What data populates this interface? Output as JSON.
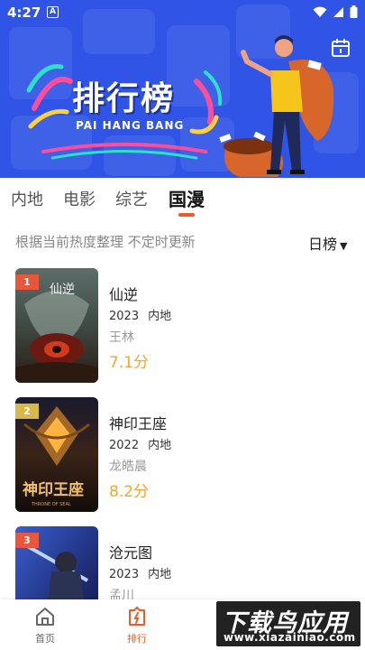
{
  "status_bar": {
    "time": "4:27",
    "notification_letter": "A"
  },
  "banner": {
    "title": "排行榜",
    "subtitle": "PAI HANG BANG"
  },
  "tabs": [
    {
      "label": "内地"
    },
    {
      "label": "电影"
    },
    {
      "label": "综艺"
    },
    {
      "label": "国漫"
    }
  ],
  "active_tab": "国漫",
  "subheader": "根据当前热度整理 不定时更新",
  "period_selector": "日榜",
  "list": [
    {
      "rank": "1",
      "title": "仙逆",
      "year": "2023",
      "region": "内地",
      "role": "王林",
      "score": "7.1分",
      "poster_title": "仙逆"
    },
    {
      "rank": "2",
      "title": "神印王座",
      "year": "2022",
      "region": "内地",
      "role": "龙皓晨",
      "score": "8.2分",
      "poster_title": "神印王座",
      "poster_subtitle": "THRONE OF SEAL"
    },
    {
      "rank": "3",
      "title": "沧元图",
      "year": "2023",
      "region": "内地",
      "role": "孟川",
      "score": ""
    }
  ],
  "rank_colors": {
    "1": "#e8563c",
    "2": "#d9b84a",
    "3": "#e8563c"
  },
  "bottom_nav": [
    {
      "label": "首页",
      "icon": "home-icon"
    },
    {
      "label": "排行",
      "icon": "ranking-icon"
    }
  ],
  "watermark": {
    "main": "下载鸟应用",
    "sub": "www.xiazainiao.com"
  },
  "colors": {
    "banner": "#2f54e6",
    "accent": "#f25a23",
    "score": "#f5a623"
  }
}
